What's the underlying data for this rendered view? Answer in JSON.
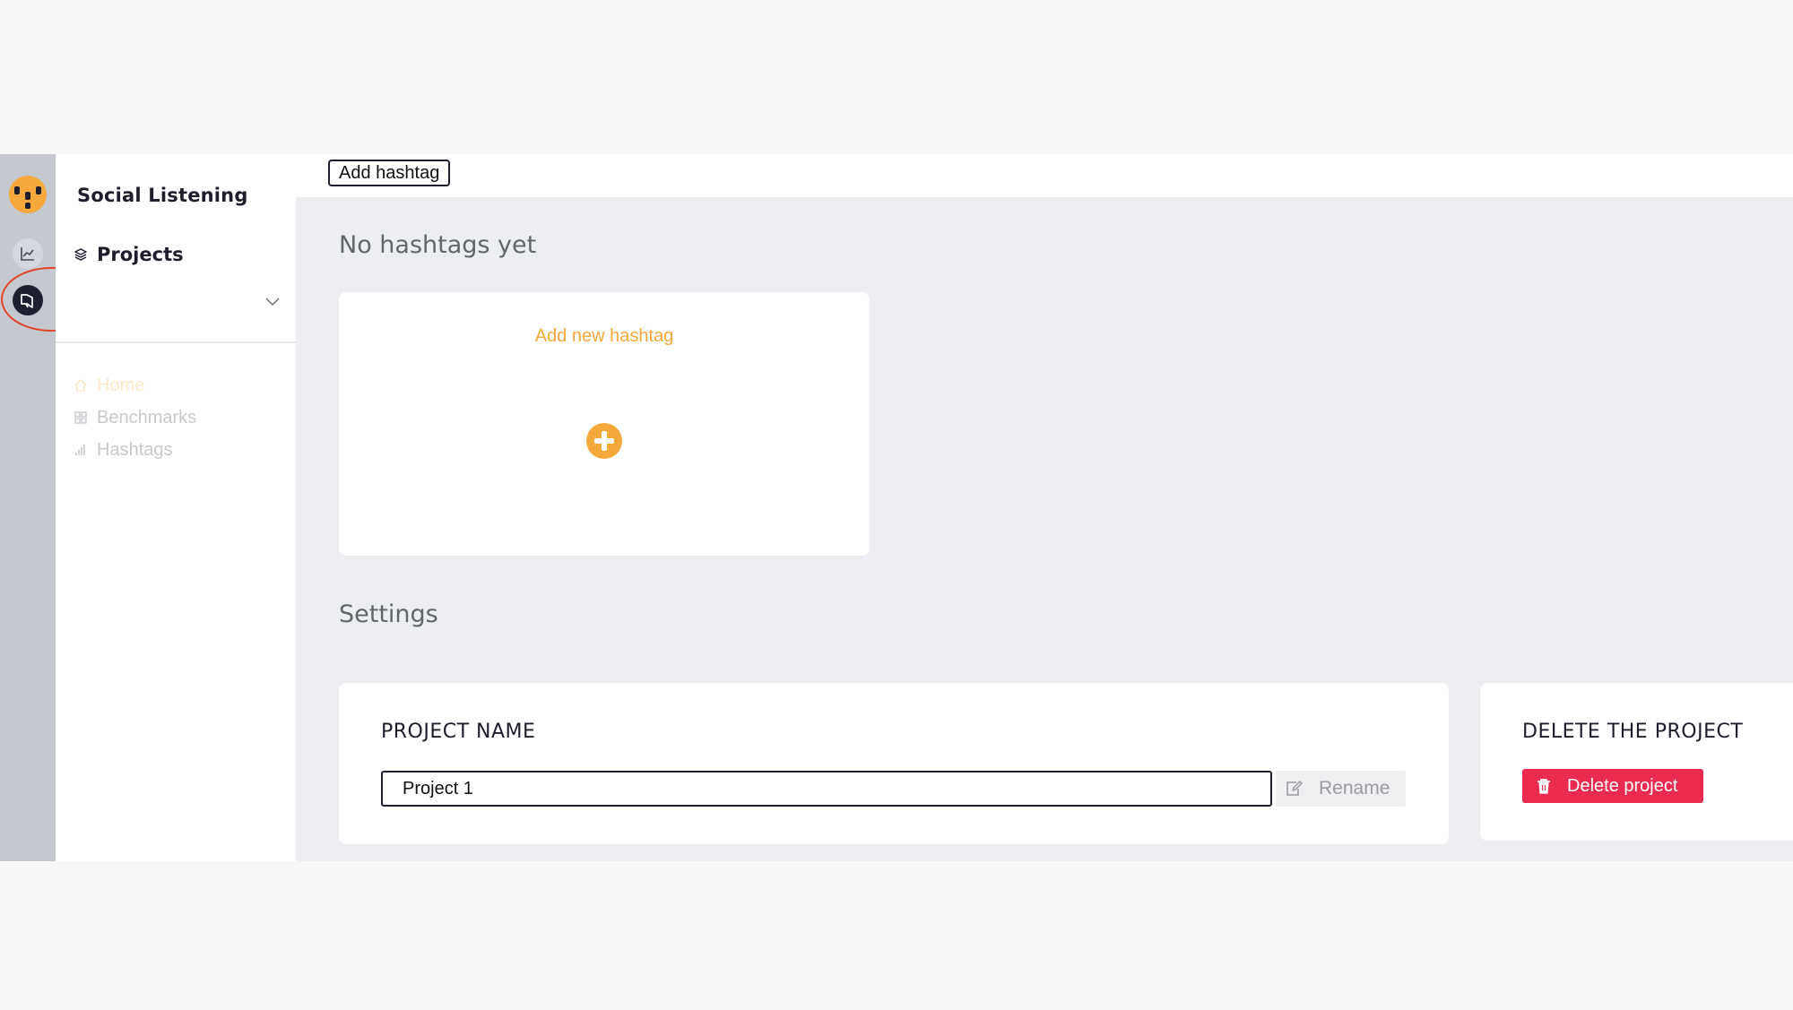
{
  "sidebar": {
    "title": "Social Listening",
    "projects_label": "Projects",
    "selected_project": "",
    "nav": [
      {
        "label": "Home",
        "icon": "home-icon"
      },
      {
        "label": "Benchmarks",
        "icon": "grid-icon"
      },
      {
        "label": "Hashtags",
        "icon": "bar-chart-icon"
      }
    ]
  },
  "rail": {
    "icons": [
      "app-logo",
      "line-chart-icon",
      "megaphone-icon"
    ]
  },
  "topbar": {
    "add_hashtag_label": "Add hashtag"
  },
  "main": {
    "empty_heading": "No hashtags yet",
    "add_new_hashtag_label": "Add new hashtag",
    "settings_heading": "Settings",
    "project_name": {
      "title": "PROJECT NAME",
      "value": "Project 1",
      "rename_label": "Rename"
    },
    "delete_project": {
      "title": "DELETE THE PROJECT",
      "button_label": "Delete project"
    }
  },
  "colors": {
    "accent": "#f6a93b",
    "danger": "#ea2b4f",
    "rail": "#c5c8cf",
    "annotation": "#e0452a"
  }
}
